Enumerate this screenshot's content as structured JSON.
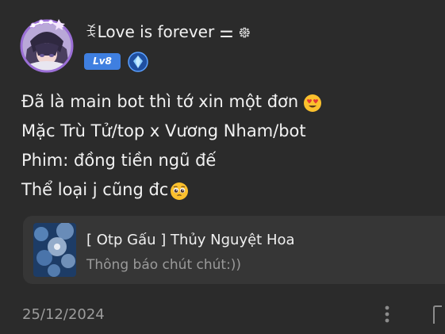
{
  "author": {
    "name": "ꉂLove is forever ⚌ ᪥",
    "level_badge": "Lv8",
    "avatar_icon": "anime-avatar-icon",
    "verify_icon": "blue-diamond-verify-icon"
  },
  "post": {
    "lines": [
      "Đã là main bot thì tớ xin một đơn",
      "Mặc Trù Tử/top x Vương Nham/bot",
      "Phim: đồng tiền ngũ đế",
      "Thể loại j cũng đc"
    ],
    "emojis": [
      "heart-eyes-emoji",
      "pleading-face-emoji"
    ]
  },
  "link_card": {
    "title": "[ Otp Gấu ] Thủy Nguyệt Hoa",
    "subtitle": "Thông báo chút chút:))",
    "thumbnail_icon": "blue-flower-thumbnail"
  },
  "footer": {
    "date": "25/12/2024",
    "more_icon": "more-vertical-icon",
    "share_icon": "share-icon"
  },
  "colors": {
    "background": "#2b2b2b",
    "card": "#363636",
    "level_badge": "#3f7fe0",
    "muted_text": "#9c9c9c"
  }
}
